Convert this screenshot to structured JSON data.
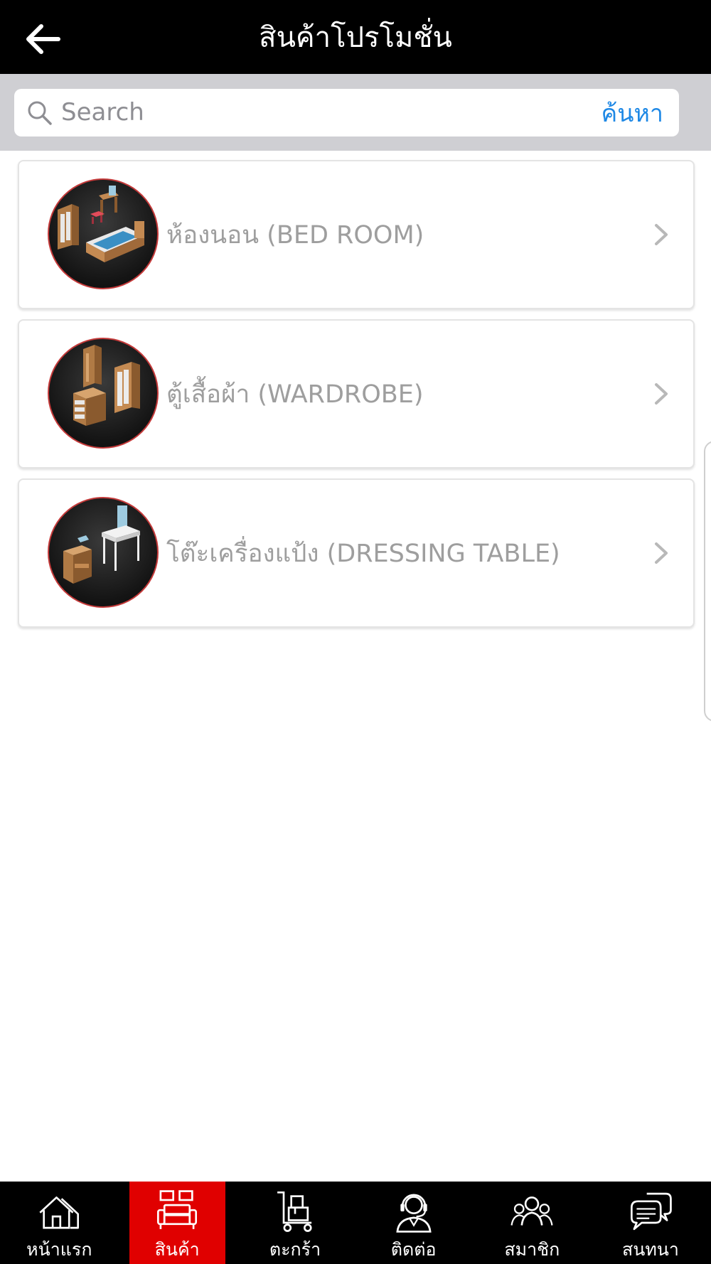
{
  "header": {
    "title": "สินค้าโปรโมชั่น",
    "back_icon": "arrow-left-icon"
  },
  "search": {
    "placeholder": "Search",
    "value": "",
    "button_label": "ค้นหา",
    "icon": "search-icon"
  },
  "categories": [
    {
      "label": "ห้องนอน (BED ROOM)",
      "icon": "bedroom-illustration"
    },
    {
      "label": "ตู้เสื้อผ้า (WARDROBE)",
      "icon": "wardrobe-illustration"
    },
    {
      "label": "โต๊ะเครื่องแป้ง (DRESSING TABLE)",
      "icon": "dressing-table-illustration"
    }
  ],
  "bottom_nav": {
    "items": [
      {
        "label": "หน้าแรก",
        "icon": "home-icon",
        "active": false
      },
      {
        "label": "สินค้า",
        "icon": "sofa-icon",
        "active": true
      },
      {
        "label": "ตะกร้า",
        "icon": "cart-icon",
        "active": false
      },
      {
        "label": "ติดต่อ",
        "icon": "support-agent-icon",
        "active": false
      },
      {
        "label": "สมาชิก",
        "icon": "members-icon",
        "active": false
      },
      {
        "label": "สนทนา",
        "icon": "chat-icon",
        "active": false
      }
    ]
  },
  "colors": {
    "header_bg": "#000000",
    "search_area_bg": "#cfcfd3",
    "accent_blue": "#1e88e5",
    "nav_active_bg": "#e00000",
    "label_gray": "#9e9e9e"
  }
}
